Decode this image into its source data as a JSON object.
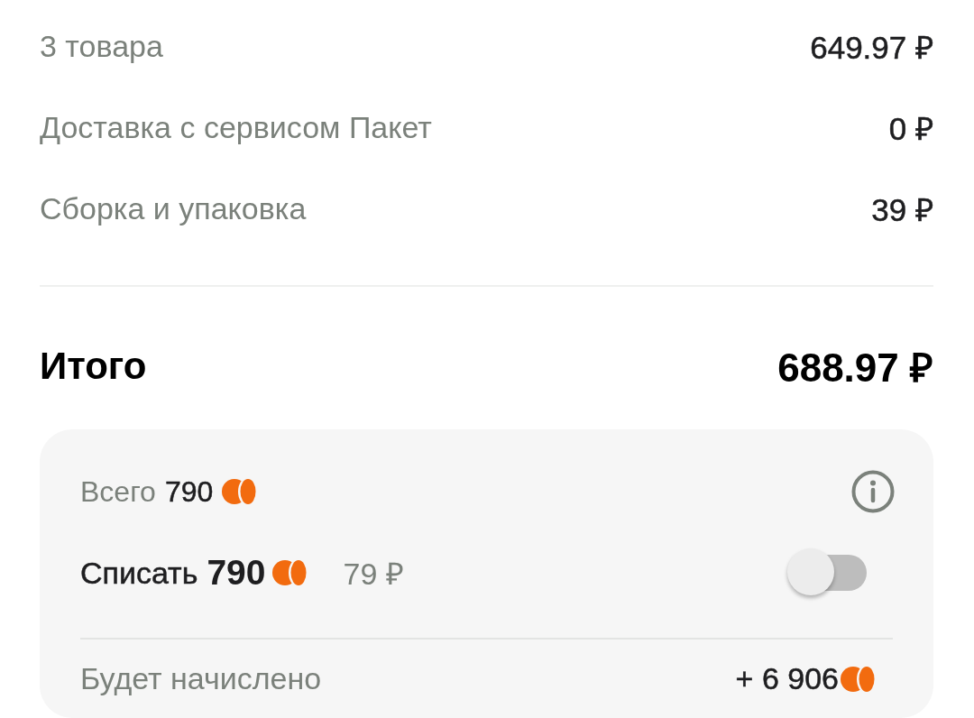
{
  "summary_rows": [
    {
      "label": "3 товара",
      "value": "649.97 ₽"
    },
    {
      "label": "Доставка с сервисом Пакет",
      "value": "0 ₽"
    },
    {
      "label": "Сборка и упаковка",
      "value": "39 ₽"
    }
  ],
  "total": {
    "label": "Итого",
    "value": "688.97 ₽"
  },
  "bonus_card": {
    "balance": {
      "label": "Всего",
      "amount": "790"
    },
    "write_off": {
      "label": "Списать",
      "amount": "790",
      "rub_equivalent": "79 ₽",
      "on": false
    },
    "accrual": {
      "label": "Будет начислено",
      "amount": "+ 6 906"
    }
  }
}
